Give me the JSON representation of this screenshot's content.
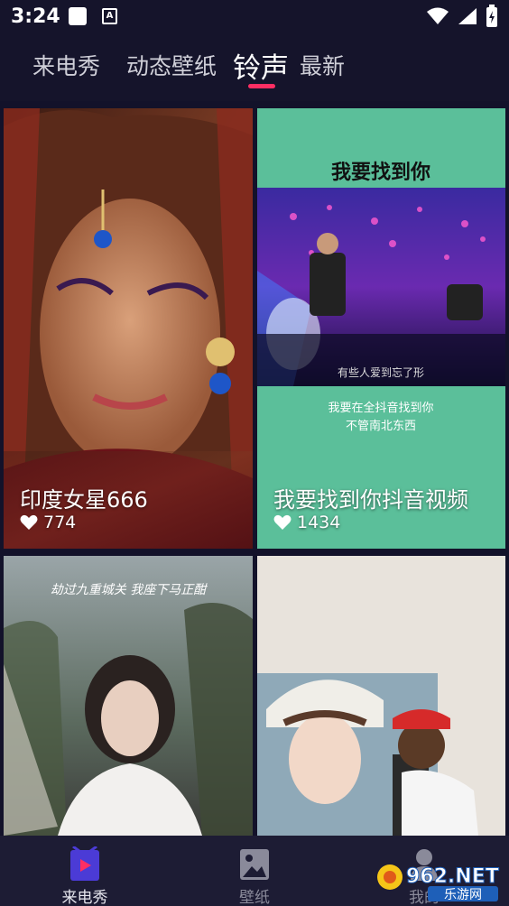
{
  "status_bar": {
    "time": "3:24"
  },
  "top_tabs": [
    "来电秀",
    "动态壁纸",
    "铃声",
    "最新"
  ],
  "active_tab_color": "#ff2e63",
  "cards": [
    {
      "title": "印度女星666",
      "likes": "774"
    },
    {
      "title": "我要找到你抖音视频",
      "likes": "1434"
    },
    {
      "title": "",
      "likes": ""
    },
    {
      "title": "",
      "likes": ""
    }
  ],
  "overlay_text": {
    "card2_top": "我要找到你",
    "card2_caption1": "有些人爱到忘了形",
    "card2_caption2": "我要在全抖音找到你",
    "card2_caption3": "不管南北东西",
    "card3_top": "劫过九重城关  我座下马正酣"
  },
  "bottom_nav": [
    {
      "label": "来电秀",
      "icon": "video-play-icon"
    },
    {
      "label": "壁纸",
      "icon": "image-icon"
    },
    {
      "label": "我的",
      "icon": "user-icon"
    }
  ],
  "watermark": {
    "brand": "962.NET",
    "sub": "乐游网"
  }
}
